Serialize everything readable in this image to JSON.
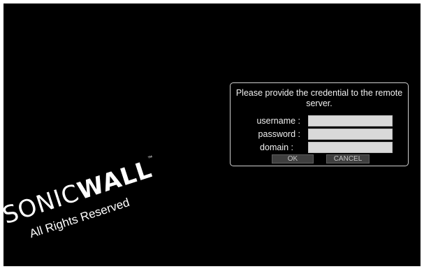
{
  "dialog": {
    "message": "Please provide the credential to the remote server.",
    "fields": {
      "username_label": "username :",
      "username_value": "",
      "password_label": "password :",
      "password_value": "",
      "domain_label": "domain :",
      "domain_value": ""
    },
    "buttons": {
      "ok_label": "OK",
      "cancel_label": "CANCEL"
    }
  },
  "branding": {
    "logo_sonic": "SONIC",
    "logo_wall": "WALL",
    "trademark": "™",
    "rights": "All Rights Reserved"
  },
  "colors": {
    "background": "#000000",
    "dialog_border": "#cfcfcf",
    "field_background": "#d9d9d9",
    "button_background": "#3f3f3f",
    "text": "#ffffff"
  }
}
